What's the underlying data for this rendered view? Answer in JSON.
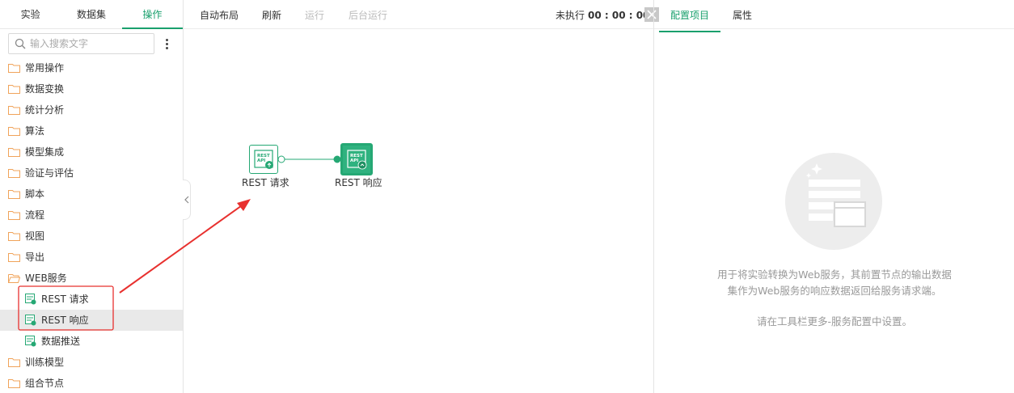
{
  "left_tabs": [
    "实验",
    "数据集",
    "操作"
  ],
  "search": {
    "placeholder": "输入搜索文字"
  },
  "tree": {
    "folders_before": [
      "常用操作",
      "数据变换",
      "统计分析",
      "算法",
      "模型集成",
      "验证与评估",
      "脚本",
      "流程",
      "视图",
      "导出",
      "WEB服务"
    ],
    "web_children": [
      "REST 请求",
      "REST 响应",
      "数据推送"
    ],
    "folders_after": [
      "训练模型",
      "组合节点"
    ]
  },
  "toolbar": {
    "auto_layout": "自动布局",
    "refresh": "刷新",
    "run": "运行",
    "bg_run": "后台运行",
    "status_label": "未执行",
    "status_time": "00 : 00 : 00"
  },
  "canvas": {
    "node1": {
      "label": "REST 请求",
      "icon_text": "REST API"
    },
    "node2": {
      "label": "REST 响应",
      "icon_text": "REST API"
    }
  },
  "right_tabs": [
    "配置项目",
    "属性"
  ],
  "right_panel": {
    "desc_line1": "用于将实验转换为Web服务，其前置节点的输出数据",
    "desc_line2": "集作为Web服务的响应数据返回给服务请求端。",
    "hint": "请在工具栏更多-服务配置中设置。"
  },
  "colors": {
    "accent": "#1aa06d",
    "node_green": "#25a874",
    "folder": "#f0a35a",
    "annotation_red": "#e8312f"
  }
}
